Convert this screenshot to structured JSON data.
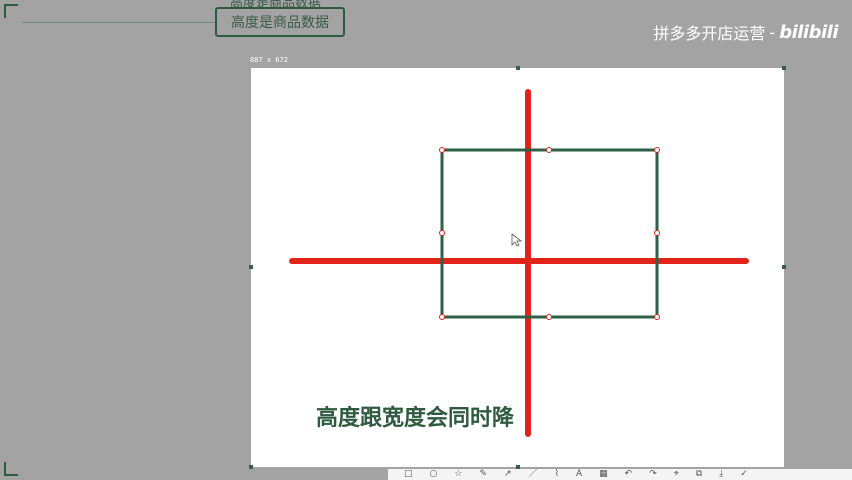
{
  "header": {
    "partial_label": "高度是商品数据",
    "layer_label": "高度是商品数据"
  },
  "watermark": {
    "text": "拼多多开店运营",
    "dash": "-",
    "logo": "bilibili"
  },
  "canvas": {
    "dimensions": "887 x 672",
    "background": "#ffffff"
  },
  "subtitle": "高度跟宽度会同时降",
  "colors": {
    "cross": "#e2231a",
    "rectangle": "#2f5f46",
    "frame": "#2e5a40",
    "workspace": "#a3a3a3"
  },
  "toolbar": {
    "icons": [
      "rect-icon",
      "ellipse-icon",
      "star-icon",
      "pen-icon",
      "arrow-icon",
      "line-icon",
      "brush-icon",
      "text-icon",
      "mosaic-icon",
      "undo-icon",
      "redo-icon",
      "pin-icon",
      "copy-icon",
      "save-icon",
      "check-icon"
    ]
  }
}
